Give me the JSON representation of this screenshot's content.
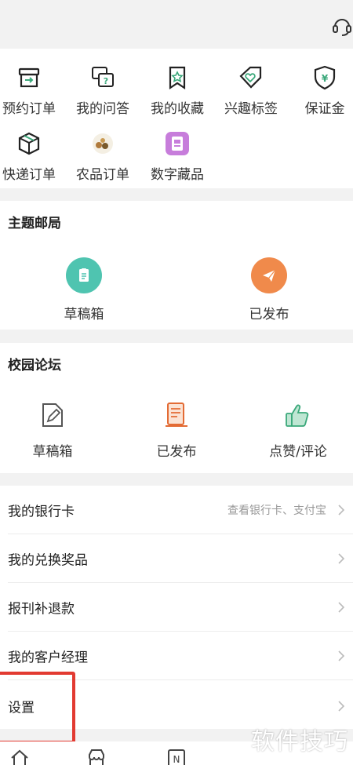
{
  "grid": {
    "items": [
      {
        "label": "预约订单",
        "icon": "order-box-icon"
      },
      {
        "label": "我的问答",
        "icon": "qa-icon"
      },
      {
        "label": "我的收藏",
        "icon": "bookmark-star-icon"
      },
      {
        "label": "兴趣标签",
        "icon": "heart-tag-icon"
      },
      {
        "label": "保证金",
        "icon": "deposit-shield-icon"
      },
      {
        "label": "快递订单",
        "icon": "parcel-icon"
      },
      {
        "label": "农品订单",
        "icon": "farm-produce-icon"
      },
      {
        "label": "数字藏品",
        "icon": "digital-collectible-icon"
      }
    ]
  },
  "mail": {
    "title": "主题邮局",
    "items": [
      {
        "label": "草稿箱",
        "color": "#4fc4b0"
      },
      {
        "label": "已发布",
        "color": "#f08a4b"
      }
    ]
  },
  "forum": {
    "title": "校园论坛",
    "items": [
      {
        "label": "草稿箱"
      },
      {
        "label": "已发布"
      },
      {
        "label": "点赞/评论"
      }
    ]
  },
  "list": {
    "rows": [
      {
        "label": "我的银行卡",
        "hint": "查看银行卡、支付宝"
      },
      {
        "label": "我的兑换奖品",
        "hint": ""
      },
      {
        "label": "报刊补退款",
        "hint": ""
      },
      {
        "label": "我的客户经理",
        "hint": ""
      },
      {
        "label": "设置",
        "hint": ""
      }
    ]
  },
  "watermark": "软件技巧",
  "colors": {
    "green": "#3aa87a",
    "highlight": "#e23a31"
  }
}
